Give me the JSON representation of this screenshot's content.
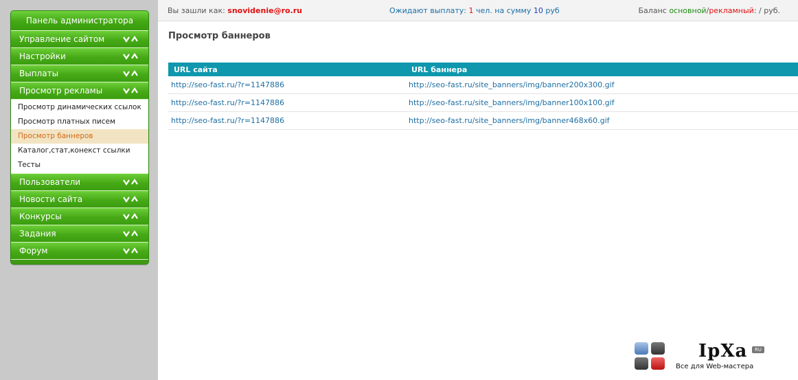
{
  "sidebar": {
    "title": "Панель администратора",
    "items": [
      {
        "label": "Управление сайтом"
      },
      {
        "label": "Настройки"
      },
      {
        "label": "Выплаты"
      },
      {
        "label": "Просмотр рекламы",
        "expanded": true,
        "subitems": [
          {
            "label": "Просмотр динамических ссылок"
          },
          {
            "label": "Просмотр платных писем"
          },
          {
            "label": "Просмотр баннеров",
            "active": true
          },
          {
            "label": "Каталог,стат,конекст ссылки"
          },
          {
            "label": "Тесты"
          }
        ]
      },
      {
        "label": "Пользователи"
      },
      {
        "label": "Новости сайта"
      },
      {
        "label": "Конкурсы"
      },
      {
        "label": "Задания"
      },
      {
        "label": "Форум"
      }
    ],
    "chevron_icon": "double-chevron-icon"
  },
  "topbar": {
    "login_prefix": "Вы зашли как:",
    "login_user": "snovidenie@ro.ru",
    "pending_prefix": "Ожидают выплату:",
    "pending_count": "1",
    "pending_mid": "чел. на сумму",
    "pending_amount": "10",
    "pending_currency": "руб",
    "balance_prefix": "Баланс",
    "balance_main": "основной",
    "balance_sep": "/",
    "balance_ad": "рекламный",
    "balance_suffix": ": / руб."
  },
  "main": {
    "title": "Просмотр баннеров",
    "table": {
      "headers": [
        "URL сайта",
        "URL баннера"
      ],
      "rows": [
        [
          "http://seo-fast.ru/?r=1147886",
          "http://seo-fast.ru/site_banners/img/banner200x300.gif"
        ],
        [
          "http://seo-fast.ru/?r=1147886",
          "http://seo-fast.ru/site_banners/img/banner100x100.gif"
        ],
        [
          "http://seo-fast.ru/?r=1147886",
          "http://seo-fast.ru/site_banners/img/banner468x60.gif"
        ]
      ]
    }
  },
  "logo": {
    "text": "IpXa",
    "badge": "RU",
    "tagline": "Все для Web-мастера"
  },
  "colors": {
    "menu_green": "#46a916",
    "table_header": "#0e97ad",
    "link": "#1e6ea1",
    "active_sub_bg": "#f2e4c2",
    "active_sub_text": "#d06a18",
    "alert_red": "#e01010"
  }
}
